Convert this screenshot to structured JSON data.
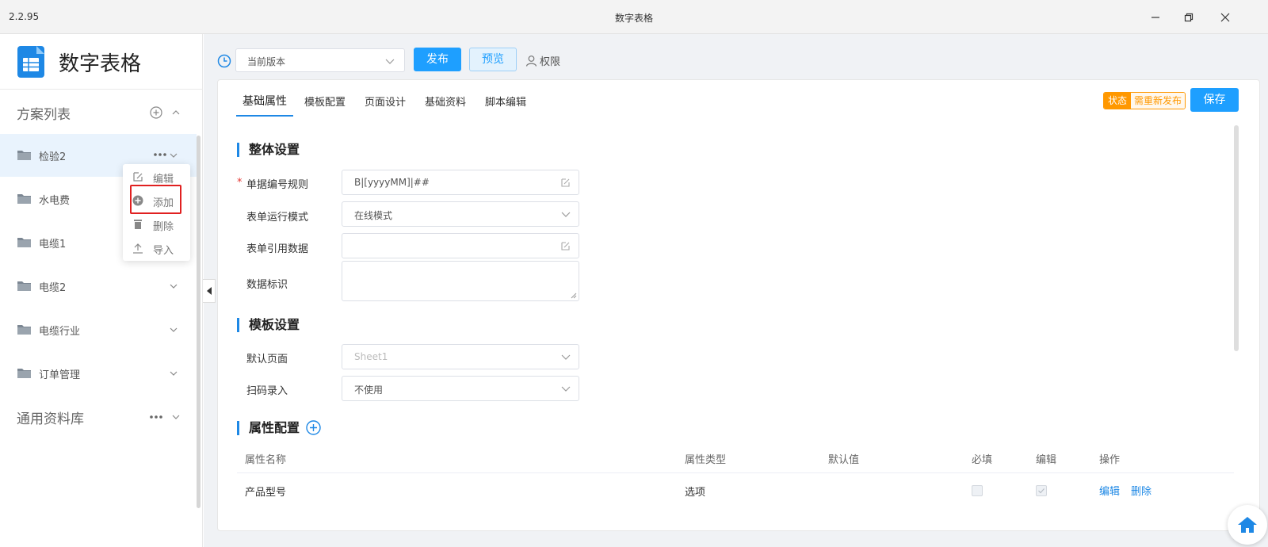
{
  "window": {
    "version": "2.2.95",
    "title": "数字表格"
  },
  "sidebar": {
    "brand": "数字表格",
    "section_schemes": "方案列表",
    "items": [
      {
        "label": "检验2"
      },
      {
        "label": "水电费"
      },
      {
        "label": "电缆1"
      },
      {
        "label": "电缆2"
      },
      {
        "label": "电缆行业"
      },
      {
        "label": "订单管理"
      }
    ],
    "section_common": "通用资料库",
    "context_menu": {
      "edit": "编辑",
      "add": "添加",
      "delete": "删除",
      "import": "导入"
    }
  },
  "toolbar": {
    "version_select": "当前版本",
    "publish": "发布",
    "preview": "预览",
    "permission": "权限"
  },
  "tabs": [
    "基础属性",
    "模板配置",
    "页面设计",
    "基础资料",
    "脚本编辑"
  ],
  "status": {
    "key": "状态",
    "value": "需重新发布"
  },
  "save": "保存",
  "overall": {
    "title": "整体设置",
    "rule_label": "单据编号规则",
    "rule_value": "B|[yyyyMM]|##",
    "mode_label": "表单运行模式",
    "mode_value": "在线模式",
    "ref_label": "表单引用数据",
    "ref_value": "",
    "tag_label": "数据标识"
  },
  "template": {
    "title": "模板设置",
    "page_label": "默认页面",
    "page_placeholder": "Sheet1",
    "scan_label": "扫码录入",
    "scan_value": "不使用"
  },
  "attrs": {
    "title": "属性配置",
    "headers": {
      "name": "属性名称",
      "type": "属性类型",
      "default": "默认值",
      "required": "必填",
      "editable": "编辑",
      "action": "操作"
    },
    "rows": [
      {
        "name": "产品型号",
        "type": "选项",
        "default": "",
        "required": false,
        "editable": true,
        "edit": "编辑",
        "delete": "删除"
      }
    ]
  },
  "colors": {
    "accent": "#1e9fff",
    "status": "#ff9800"
  }
}
